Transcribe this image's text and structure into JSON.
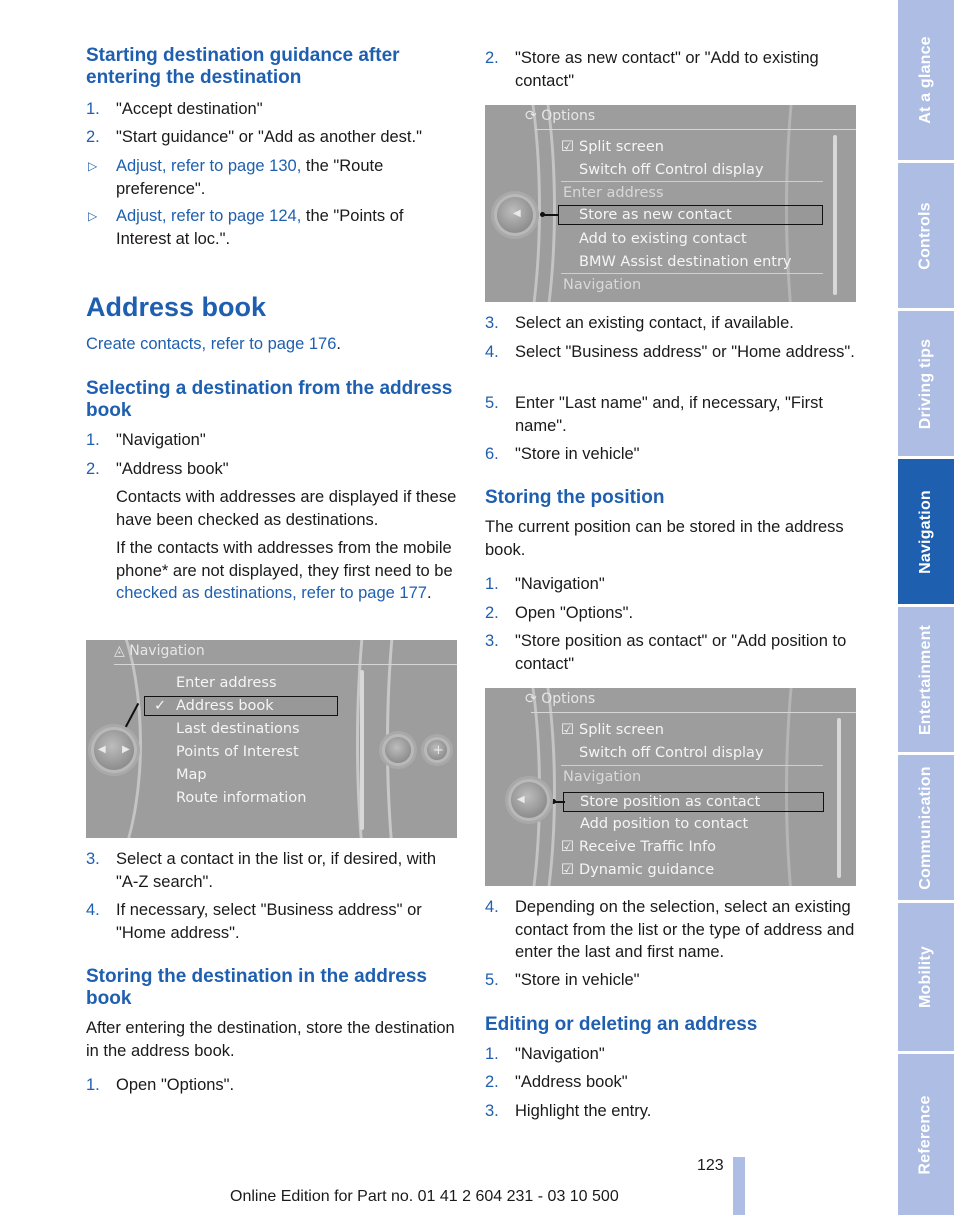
{
  "left": {
    "section1": {
      "heading": "Starting destination guidance after entering the destination",
      "steps": [
        {
          "num": "1.",
          "text": "\"Accept destination\""
        },
        {
          "num": "2.",
          "text": "\"Start guidance\" or \"Add as another dest.\""
        }
      ],
      "bullets": [
        {
          "link": "Adjust, refer to page 130,",
          "text": " the \"Route preference\"."
        },
        {
          "link": "Adjust, refer to page 124,",
          "text": " the \"Points of Interest at loc.\"."
        }
      ]
    },
    "address_book": {
      "title": "Address book",
      "create_link": "Create contacts, refer to page 176",
      "create_suffix": "."
    },
    "section2": {
      "heading": "Selecting a destination from the address book",
      "steps": [
        {
          "num": "1.",
          "text": "\"Navigation\""
        },
        {
          "num": "2.",
          "text": "\"Address book\""
        }
      ],
      "note1": "Contacts with addresses are displayed if these have been checked as destinations.",
      "note2_pre": "If the contacts with addresses from the mobile phone* are not displayed, they first need to be ",
      "note2_link": "checked as destinations, refer to page 177",
      "note2_post": ".",
      "steps_after": [
        {
          "num": "3.",
          "text": "Select a contact in the list or, if desired, with \"A-Z search\"."
        },
        {
          "num": "4.",
          "text": "If necessary, select \"Business address\" or \"Home address\"."
        }
      ]
    },
    "screen_nav": {
      "title": "Navigation",
      "items": [
        "Enter address",
        "Address book",
        "Last destinations",
        "Points of Interest",
        "Map",
        "Route information"
      ],
      "selected": "Address book",
      "selected_mark": "✓"
    },
    "section3": {
      "heading": "Storing the destination in the address book",
      "intro": "After entering the destination, store the destination in the address book.",
      "steps": [
        {
          "num": "1.",
          "text": "Open \"Options\"."
        }
      ]
    }
  },
  "right": {
    "section3_cont": {
      "steps": [
        {
          "num": "2.",
          "text": "\"Store as new contact\" or \"Add to existing contact\""
        }
      ],
      "steps_after": [
        {
          "num": "3.",
          "text": "Select an existing contact, if available."
        },
        {
          "num": "4.",
          "text": "Select \"Business address\" or \"Home address\"."
        },
        {
          "num": "5.",
          "text": "Enter \"Last name\" and, if necessary, \"First name\"."
        },
        {
          "num": "6.",
          "text": "\"Store in vehicle\""
        }
      ]
    },
    "screen_options1": {
      "title": "Options",
      "split_screen": "Split screen",
      "switch_off": "Switch off Control display",
      "group_label": "Enter address",
      "items": [
        "Store as new contact",
        "Add to existing contact",
        "BMW Assist destination entry"
      ],
      "selected": "Store as new contact",
      "footer_group": "Navigation"
    },
    "section4": {
      "heading": "Storing the position",
      "intro": "The current position can be stored in the address book.",
      "steps": [
        {
          "num": "1.",
          "text": "\"Navigation\""
        },
        {
          "num": "2.",
          "text": "Open \"Options\"."
        },
        {
          "num": "3.",
          "text": "\"Store position as contact\" or \"Add position to contact\""
        }
      ],
      "steps_after": [
        {
          "num": "4.",
          "text": "Depending on the selection, select an existing contact from the list or the type of address and enter the last and first name."
        },
        {
          "num": "5.",
          "text": "\"Store in vehicle\""
        }
      ]
    },
    "screen_options2": {
      "title": "Options",
      "split_screen": "Split screen",
      "switch_off": "Switch off Control display",
      "group_label": "Navigation",
      "items": [
        "Store position as contact",
        "Add position to contact"
      ],
      "selected": "Store position as contact",
      "checked_items": [
        "Receive Traffic Info",
        "Dynamic guidance"
      ]
    },
    "section5": {
      "heading": "Editing or deleting an address",
      "steps": [
        {
          "num": "1.",
          "text": "\"Navigation\""
        },
        {
          "num": "2.",
          "text": "\"Address book\""
        },
        {
          "num": "3.",
          "text": "Highlight the entry."
        }
      ]
    }
  },
  "side_tabs": [
    {
      "label": "At a glance",
      "active": false
    },
    {
      "label": "Controls",
      "active": false
    },
    {
      "label": "Driving tips",
      "active": false
    },
    {
      "label": "Navigation",
      "active": true
    },
    {
      "label": "Entertainment",
      "active": false
    },
    {
      "label": "Communication",
      "active": false
    },
    {
      "label": "Mobility",
      "active": false
    },
    {
      "label": "Reference",
      "active": false
    }
  ],
  "footer": {
    "page_number": "123",
    "edition": "Online Edition for Part no. 01 41 2 604 231 - 03 10 500"
  },
  "colors": {
    "accent": "#1f5fb0",
    "tab_inactive": "#aebde3",
    "screen_bg": "#9d9d9d"
  }
}
